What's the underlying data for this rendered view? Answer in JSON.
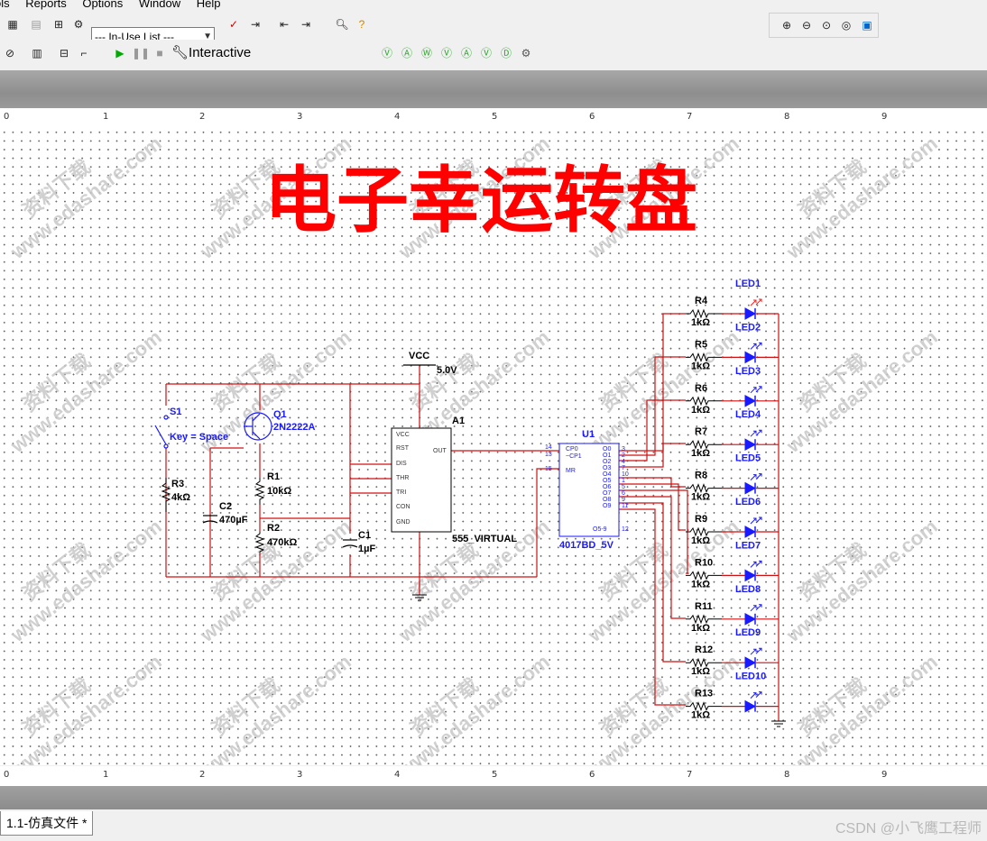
{
  "menu": [
    "ols",
    "Reports",
    "Options",
    "Window",
    "Help"
  ],
  "toolbar": {
    "inuse_list": "--- In-Use List ---",
    "interactive": "Interactive"
  },
  "ruler": {
    "numbers": [
      "0",
      "1",
      "2",
      "3",
      "4",
      "5",
      "6",
      "7",
      "8",
      "9"
    ]
  },
  "schematic": {
    "title": "电子幸运转盘",
    "watermark_url": "www.edashare.com",
    "watermark_cn": "资料下载",
    "labels": {
      "vcc": "VCC",
      "vcc_val": "5.0V",
      "s1": "S1",
      "key": "Key = Space",
      "q1": "Q1",
      "q1_part": "2N2222A",
      "r1": "R1",
      "r1_val": "10kΩ",
      "r2": "R2",
      "r2_val": "470kΩ",
      "r3": "R3",
      "r3_val": "4kΩ",
      "c1": "C1",
      "c1_val": "1µF",
      "c2": "C2",
      "c2_val": "470µF",
      "a1": "A1",
      "a1_part": "555_VIRTUAL",
      "u1": "U1",
      "u1_part": "4017BD_5V"
    },
    "pins555": [
      "VCC",
      "RST",
      "DIS",
      "THR",
      "TRI",
      "CON",
      "GND",
      "OUT"
    ],
    "pins4017_left": [
      "CP0",
      "~CP1",
      "MR"
    ],
    "pins4017_left_nums": [
      "14",
      "13",
      "15"
    ],
    "pins4017_right": [
      "O0",
      "O1",
      "O2",
      "O3",
      "O4",
      "O5",
      "O6",
      "O7",
      "O8",
      "O9"
    ],
    "pins4017_right_nums": [
      "3",
      "2",
      "4",
      "7",
      "10",
      "1",
      "5",
      "6",
      "9",
      "11"
    ],
    "pins4017_co": "O5-9",
    "pins4017_co_num": "12",
    "resistors": [
      "R4",
      "R5",
      "R6",
      "R7",
      "R8",
      "R9",
      "R10",
      "R11",
      "R12",
      "R13"
    ],
    "resistor_value": "1kΩ",
    "leds": [
      "LED1",
      "LED2",
      "LED3",
      "LED4",
      "LED5",
      "LED6",
      "LED7",
      "LED8",
      "LED9",
      "LED10"
    ]
  },
  "tab": {
    "label": "1.1-仿真文件 *"
  },
  "credit": "CSDN @小飞鹰工程师",
  "colors": {
    "wire": "#d01010",
    "part": "#1a1aff",
    "title": "#ff0000"
  }
}
